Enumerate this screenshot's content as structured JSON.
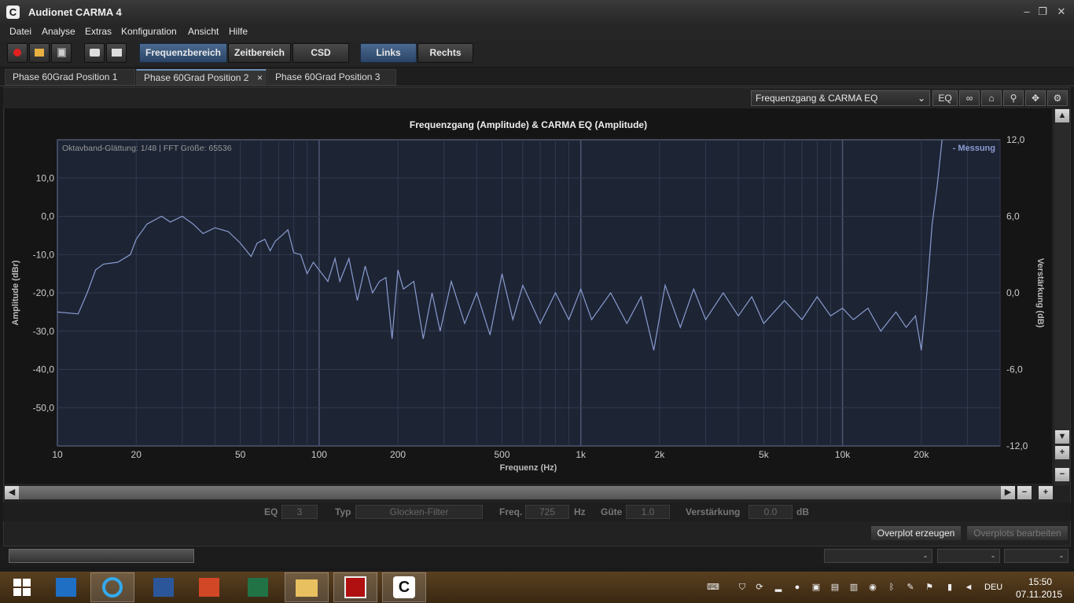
{
  "window": {
    "title": "Audionet CARMA 4",
    "icon_letter": "C"
  },
  "menu": [
    "Datei",
    "Analyse",
    "Extras",
    "Konfiguration",
    "Ansicht",
    "Hilfe"
  ],
  "toolbar": {
    "views": [
      "Frequenzbereich",
      "Zeitbereich",
      "CSD"
    ],
    "channels": [
      "Links",
      "Rechts"
    ],
    "selected_view": "Frequenzbereich",
    "selected_channel": "Links"
  },
  "tabs": [
    {
      "label": "Phase 60Grad Position 1"
    },
    {
      "label": "Phase 60Grad Position 2",
      "close": "×"
    },
    {
      "label": "Phase 60Grad Position 3"
    }
  ],
  "charttool": {
    "dropdown": "Frequenzgang & CARMA EQ",
    "eq": "EQ"
  },
  "chart_data": {
    "type": "line",
    "title": "Frequenzgang (Amplitude) & CARMA EQ (Amplitude)",
    "info": "Oktavband-Glättung: 1/48 | FFT Größe: 65536",
    "legend": "- Messung",
    "xlabel": "Frequenz (Hz)",
    "ylabel": "Amplitude (dBr)",
    "y2label": "Verstärkung (dB)",
    "x_scale": "log",
    "xlim": [
      10,
      40000
    ],
    "ylim": [
      -60,
      20
    ],
    "y2lim": [
      -12,
      12
    ],
    "x_ticks": [
      "10",
      "20",
      "50",
      "100",
      "200",
      "500",
      "1k",
      "2k",
      "5k",
      "10k",
      "20k"
    ],
    "y_ticks": [
      "10,0",
      "0,0",
      "-10,0",
      "-20,0",
      "-30,0",
      "-40,0",
      "-50,0"
    ],
    "y2_ticks": [
      "12,0",
      "6,0",
      "0,0",
      "-6,0",
      "-12,0"
    ],
    "grid": true,
    "legend_position": "top-right",
    "series": [
      {
        "name": "Messung",
        "points": [
          [
            10,
            -25
          ],
          [
            12,
            -25.5
          ],
          [
            13,
            -20
          ],
          [
            14,
            -14
          ],
          [
            15,
            -12.5
          ],
          [
            17,
            -12
          ],
          [
            19,
            -10
          ],
          [
            20,
            -6
          ],
          [
            22,
            -2
          ],
          [
            25,
            0
          ],
          [
            27,
            -1.5
          ],
          [
            30,
            0
          ],
          [
            33,
            -2
          ],
          [
            36,
            -4.5
          ],
          [
            40,
            -3
          ],
          [
            45,
            -4
          ],
          [
            50,
            -7
          ],
          [
            55,
            -10.5
          ],
          [
            58,
            -7
          ],
          [
            62,
            -6
          ],
          [
            65,
            -9
          ],
          [
            68,
            -6.5
          ],
          [
            72,
            -5
          ],
          [
            76,
            -3.5
          ],
          [
            80,
            -9.5
          ],
          [
            85,
            -10
          ],
          [
            90,
            -15
          ],
          [
            95,
            -12
          ],
          [
            100,
            -14
          ],
          [
            108,
            -17
          ],
          [
            115,
            -11
          ],
          [
            120,
            -17
          ],
          [
            130,
            -11
          ],
          [
            140,
            -22
          ],
          [
            150,
            -13
          ],
          [
            160,
            -20
          ],
          [
            170,
            -17
          ],
          [
            180,
            -16
          ],
          [
            190,
            -32
          ],
          [
            200,
            -14
          ],
          [
            210,
            -19
          ],
          [
            230,
            -17
          ],
          [
            250,
            -32
          ],
          [
            270,
            -20
          ],
          [
            290,
            -30
          ],
          [
            320,
            -17
          ],
          [
            360,
            -28
          ],
          [
            400,
            -20
          ],
          [
            450,
            -31
          ],
          [
            500,
            -15
          ],
          [
            550,
            -27
          ],
          [
            600,
            -18
          ],
          [
            700,
            -28
          ],
          [
            800,
            -20
          ],
          [
            900,
            -27
          ],
          [
            1000,
            -19
          ],
          [
            1100,
            -27
          ],
          [
            1300,
            -20
          ],
          [
            1500,
            -28
          ],
          [
            1700,
            -21
          ],
          [
            1900,
            -35
          ],
          [
            2100,
            -18
          ],
          [
            2400,
            -29
          ],
          [
            2700,
            -19
          ],
          [
            3000,
            -27
          ],
          [
            3500,
            -20
          ],
          [
            4000,
            -26
          ],
          [
            4500,
            -21
          ],
          [
            5000,
            -28
          ],
          [
            6000,
            -22
          ],
          [
            7000,
            -27
          ],
          [
            8000,
            -21
          ],
          [
            9000,
            -26
          ],
          [
            10000,
            -24
          ],
          [
            11000,
            -27
          ],
          [
            12500,
            -24
          ],
          [
            14000,
            -30
          ],
          [
            16000,
            -25
          ],
          [
            17500,
            -29
          ],
          [
            19000,
            -26
          ],
          [
            20000,
            -35
          ],
          [
            21000,
            -20
          ],
          [
            22000,
            -2
          ],
          [
            23000,
            8
          ],
          [
            24000,
            20
          ]
        ]
      }
    ]
  },
  "eq": {
    "eq_label": "EQ",
    "eq_value": "3",
    "typ_label": "Typ",
    "typ_value": "Glocken-Filter",
    "freq_label": "Freq.",
    "freq_value": "725",
    "freq_unit": "Hz",
    "guete_label": "Güte",
    "guete_value": "1.0",
    "gain_label": "Verstärkung",
    "gain_value": "0.0",
    "gain_unit": "dB"
  },
  "overplot": {
    "create": "Overplot erzeugen",
    "edit": "Overplots bearbeiten"
  },
  "status": {
    "box1": "-",
    "box2": "-",
    "box3": "-"
  },
  "taskbar": {
    "lang": "DEU",
    "time": "15:50",
    "date": "07.11.2015"
  },
  "colors": {
    "accent": "#4a6a90",
    "curve": "#8a9cd0",
    "plot_bg": "#1d2434"
  }
}
